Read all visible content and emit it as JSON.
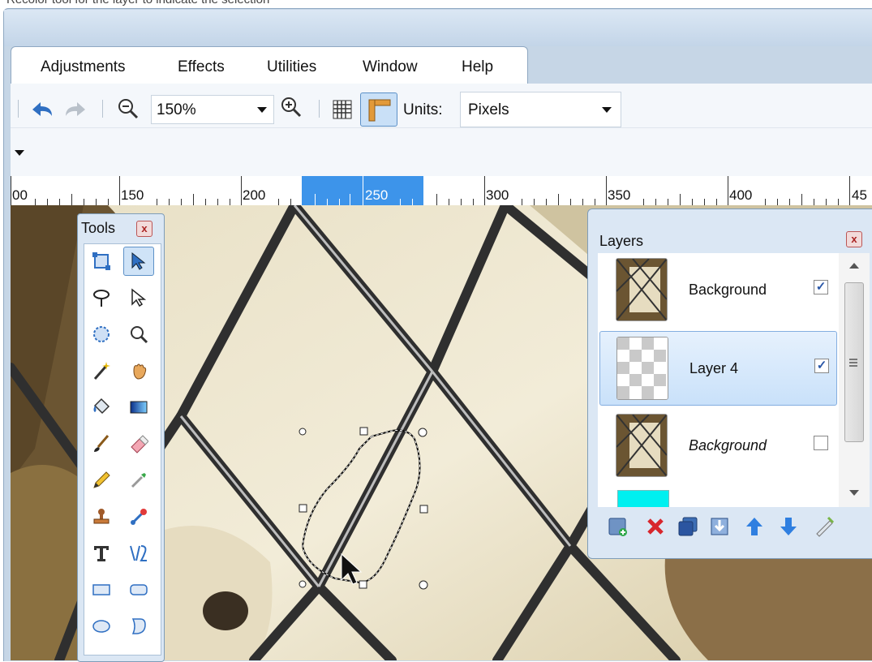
{
  "caption_fragment": "Recolor tool for the layer to indicate the selection",
  "menu": [
    "Adjustments",
    "Effects",
    "Utilities",
    "Window",
    "Help"
  ],
  "toolbar": {
    "zoom_value": "150%",
    "units_label": "Units:",
    "units_value": "Pixels"
  },
  "ruler": {
    "labels": [
      "00",
      "150",
      "200",
      "250",
      "300",
      "350",
      "400",
      "45"
    ]
  },
  "tools_panel": {
    "title": "Tools",
    "close": "x",
    "items": [
      "rectangle-select-icon",
      "move-selection-icon",
      "lasso-select-icon",
      "move-selected-icon",
      "ellipse-select-icon",
      "zoom-icon",
      "magic-wand-icon",
      "pan-icon",
      "paint-bucket-icon",
      "gradient-icon",
      "paintbrush-icon",
      "eraser-icon",
      "pencil-icon",
      "color-picker-icon",
      "clone-stamp-icon",
      "recolor-icon",
      "text-icon",
      "line-curve-icon",
      "rectangle-icon",
      "rounded-rectangle-icon",
      "ellipse-icon",
      "freeform-shape-icon"
    ]
  },
  "layers_panel": {
    "title": "Layers",
    "close": "x",
    "rows": [
      {
        "name": "Background",
        "checked": "✓",
        "selected": false,
        "italic": false
      },
      {
        "name": "Layer 4",
        "checked": "✓",
        "selected": true,
        "italic": false
      },
      {
        "name": "Background",
        "checked": "",
        "selected": false,
        "italic": true
      }
    ],
    "buttons": [
      "add-layer-icon",
      "delete-layer-icon",
      "duplicate-layer-icon",
      "merge-layer-down-icon",
      "move-layer-up-icon",
      "move-layer-down-icon",
      "layer-properties-icon"
    ]
  }
}
